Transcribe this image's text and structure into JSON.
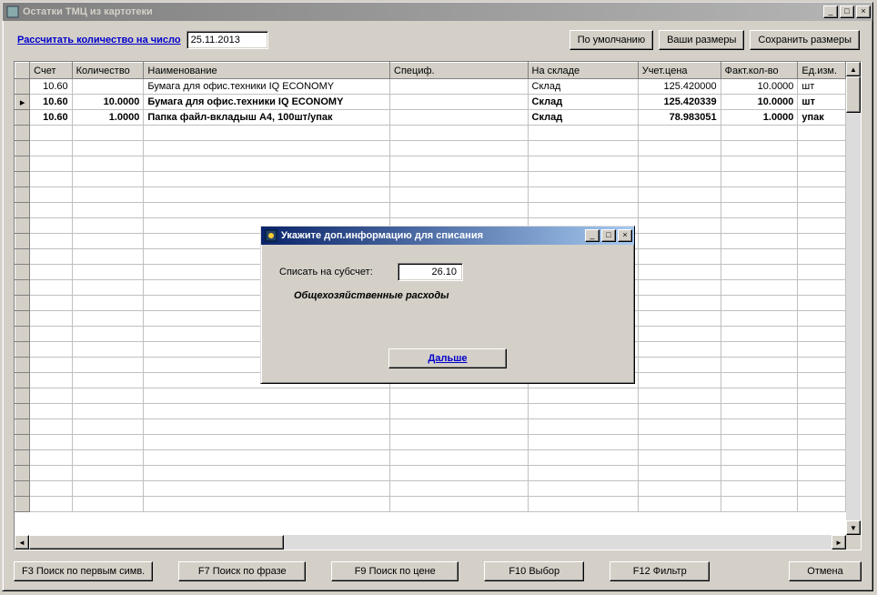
{
  "main": {
    "title": "Остатки ТМЦ из картотеки",
    "toolbar": {
      "calc_link": "Рассчитать количество на число",
      "date_value": "25.11.2013",
      "btn_defaults": "По умолчанию",
      "btn_your_sizes": "Ваши размеры",
      "btn_save_sizes": "Сохранить размеры"
    },
    "grid": {
      "headers": {
        "account": "Счет",
        "qty": "Количество",
        "name": "Наименование",
        "spec": "Специф.",
        "warehouse": "На складе",
        "acc_price": "Учет.цена",
        "fact_qty": "Факт.кол-во",
        "unit": "Ед.изм."
      },
      "rows": [
        {
          "marker": "",
          "account": "10.60",
          "qty": "",
          "name": "Бумага для офис.техники IQ ECONOMY",
          "spec": "",
          "warehouse": "Склад",
          "acc_price": "125.420000",
          "fact_qty": "10.0000",
          "unit": "шт",
          "bold": false
        },
        {
          "marker": "▸",
          "account": "10.60",
          "qty": "10.0000",
          "name": "Бумага для офис.техники IQ ECONOMY",
          "spec": "",
          "warehouse": "Склад",
          "acc_price": "125.420339",
          "fact_qty": "10.0000",
          "unit": "шт",
          "bold": true
        },
        {
          "marker": "",
          "account": "10.60",
          "qty": "1.0000",
          "name": "Папка файл-вкладыш А4, 100шт/упак",
          "spec": "",
          "warehouse": "Склад",
          "acc_price": "78.983051",
          "fact_qty": "1.0000",
          "unit": "упак",
          "bold": true
        }
      ]
    },
    "bottom": {
      "f3": "F3 Поиск по первым симв.",
      "f7": "F7 Поиск по фразе",
      "f9": "F9 Поиск по цене",
      "f10": "F10 Выбор",
      "f12": "F12 Фильтр",
      "cancel": "Отмена"
    }
  },
  "modal": {
    "title": "Укажите доп.информацию для списания",
    "label": "Списать на субсчет:",
    "value": "26.10",
    "desc": "Общехозяйственные расходы",
    "next": "Дальше"
  }
}
